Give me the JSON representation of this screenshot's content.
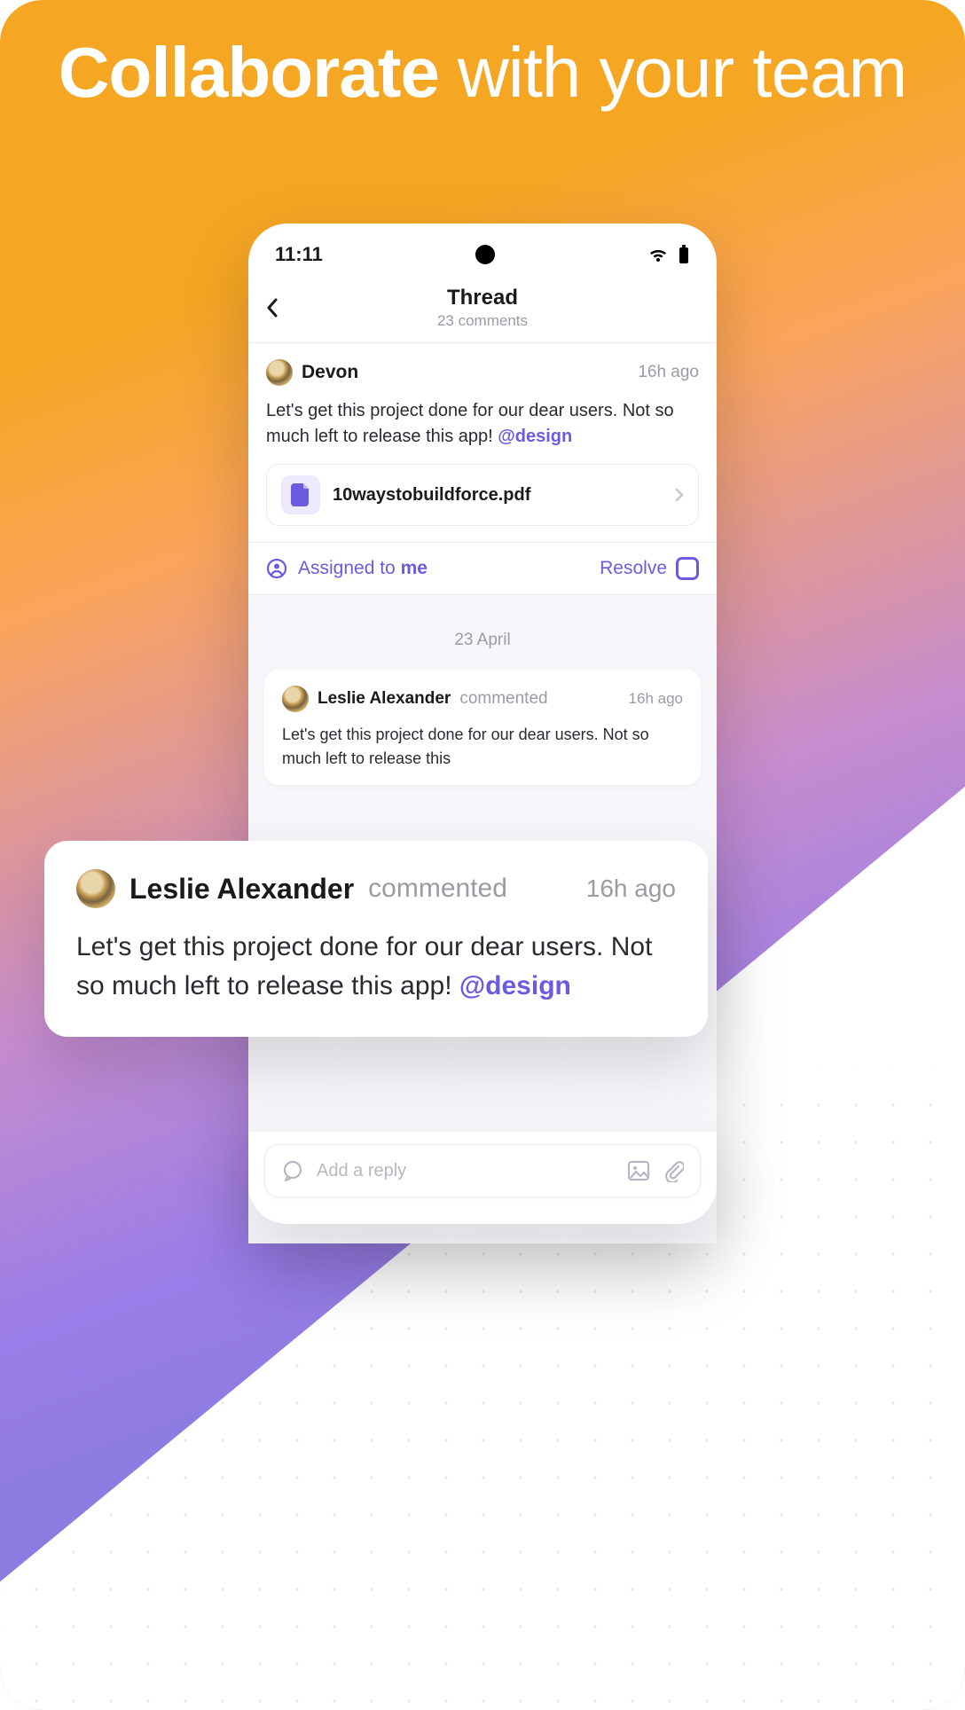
{
  "headline": {
    "bold": "Collaborate",
    "rest": " with your team"
  },
  "status": {
    "time": "11:11"
  },
  "thread": {
    "title": "Thread",
    "subtitle": "23 comments"
  },
  "original": {
    "author": "Devon",
    "time": "16h ago",
    "body_plain": "Let's get this project done for our dear users. Not so much left to release this app! ",
    "mention": "@design",
    "attachment": "10waystobuildforce.pdf"
  },
  "actions": {
    "assigned_pre": "Assigned to ",
    "assigned_me": "me",
    "resolve": "Resolve"
  },
  "date_separator": "23 April",
  "comment": {
    "author": "Leslie Alexander",
    "verb": "commented",
    "time": "16h ago",
    "body": "Let's get this project done for our dear users. Not so much left to release this"
  },
  "popout": {
    "author": "Leslie Alexander",
    "verb": "commented",
    "time": "16h ago",
    "body_plain": "Let's get this project done for our dear users. Not so much left to release this app! ",
    "mention": "@design"
  },
  "reply": {
    "placeholder": "Add a reply"
  }
}
